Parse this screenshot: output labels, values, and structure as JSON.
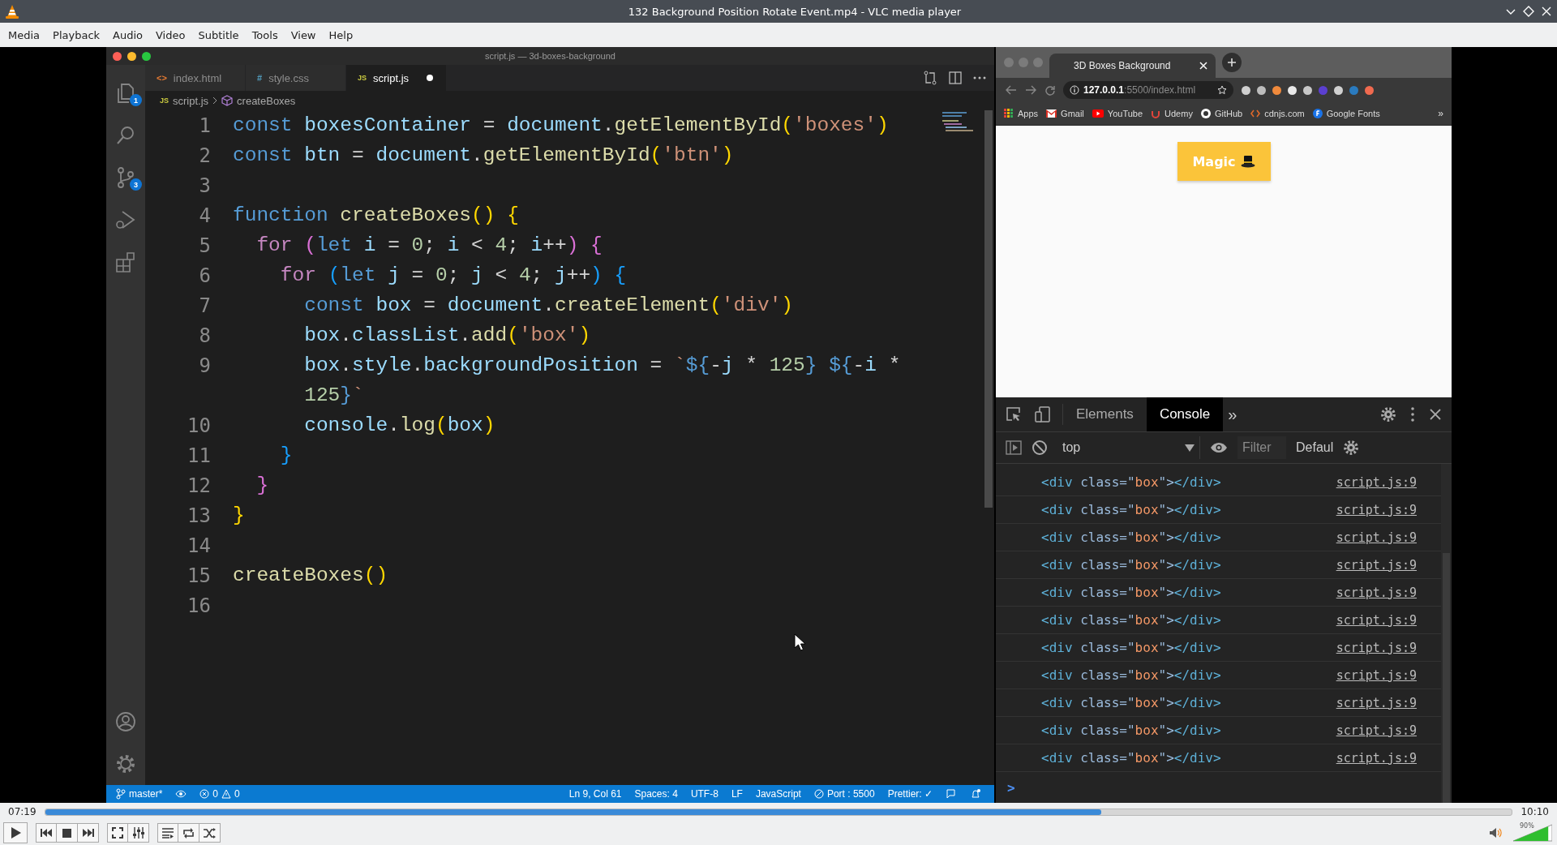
{
  "window": {
    "title": "132 Background Position Rotate Event.mp4 - VLC media player"
  },
  "menu": [
    "Media",
    "Playback",
    "Audio",
    "Video",
    "Subtitle",
    "Tools",
    "View",
    "Help"
  ],
  "editor": {
    "title": "script.js — 3d-boxes-background",
    "activity_bar": [
      {
        "kind": "files",
        "badge": "1"
      },
      {
        "kind": "search"
      },
      {
        "kind": "source-control",
        "badge": "3"
      },
      {
        "kind": "run"
      },
      {
        "kind": "extensions"
      }
    ],
    "activity_bottom": [
      {
        "kind": "account"
      },
      {
        "kind": "settings"
      }
    ],
    "tabs": [
      {
        "icon": "<>",
        "kind": "html",
        "label": "index.html",
        "selected": false,
        "modified": false
      },
      {
        "icon": "#",
        "kind": "css",
        "label": "style.css",
        "selected": false,
        "modified": false
      },
      {
        "icon": "JS",
        "kind": "js",
        "label": "script.js",
        "selected": true,
        "modified": true
      }
    ],
    "breadcrumb": [
      {
        "kind": "file",
        "icon": "JS",
        "label": "script.js"
      },
      {
        "kind": "symbol",
        "label": "createBoxes"
      }
    ],
    "lines": [
      {
        "number": "1",
        "tokens": [
          {
            "text": "const ",
            "kind": "kw"
          },
          {
            "text": "boxesContainer",
            "kind": "var"
          },
          {
            "text": " = ",
            "kind": "op"
          },
          {
            "text": "document",
            "kind": "var"
          },
          {
            "text": ".",
            "kind": "op"
          },
          {
            "text": "getElementById",
            "kind": "fn"
          },
          {
            "text": "(",
            "kind": "b1"
          },
          {
            "text": "'boxes'",
            "kind": "str"
          },
          {
            "text": ")",
            "kind": "b1"
          }
        ]
      },
      {
        "number": "2",
        "tokens": [
          {
            "text": "const ",
            "kind": "kw"
          },
          {
            "text": "btn",
            "kind": "var"
          },
          {
            "text": " = ",
            "kind": "op"
          },
          {
            "text": "document",
            "kind": "var"
          },
          {
            "text": ".",
            "kind": "op"
          },
          {
            "text": "getElementById",
            "kind": "fn"
          },
          {
            "text": "(",
            "kind": "b1"
          },
          {
            "text": "'btn'",
            "kind": "str"
          },
          {
            "text": ")",
            "kind": "b1"
          }
        ]
      },
      {
        "number": "3"
      },
      {
        "number": "4",
        "tokens": [
          {
            "text": "function ",
            "kind": "kw"
          },
          {
            "text": "createBoxes",
            "kind": "fn"
          },
          {
            "text": "() {",
            "kind": "b1"
          }
        ]
      },
      {
        "number": "5",
        "tokens": [
          {
            "text": "  for ",
            "kind": "ctrl"
          },
          {
            "text": "(",
            "kind": "b2"
          },
          {
            "text": "let ",
            "kind": "kw"
          },
          {
            "text": "i",
            "kind": "var"
          },
          {
            "text": " = ",
            "kind": "op"
          },
          {
            "text": "0",
            "kind": "num"
          },
          {
            "text": "; ",
            "kind": "op"
          },
          {
            "text": "i",
            "kind": "var"
          },
          {
            "text": " < ",
            "kind": "op"
          },
          {
            "text": "4",
            "kind": "num"
          },
          {
            "text": "; ",
            "kind": "op"
          },
          {
            "text": "i",
            "kind": "var"
          },
          {
            "text": "++",
            "kind": "op"
          },
          {
            "text": ") {",
            "kind": "b2"
          }
        ]
      },
      {
        "number": "6",
        "tokens": [
          {
            "text": "    for ",
            "kind": "ctrl"
          },
          {
            "text": "(",
            "kind": "b3"
          },
          {
            "text": "let ",
            "kind": "kw"
          },
          {
            "text": "j",
            "kind": "var"
          },
          {
            "text": " = ",
            "kind": "op"
          },
          {
            "text": "0",
            "kind": "num"
          },
          {
            "text": "; ",
            "kind": "op"
          },
          {
            "text": "j",
            "kind": "var"
          },
          {
            "text": " < ",
            "kind": "op"
          },
          {
            "text": "4",
            "kind": "num"
          },
          {
            "text": "; ",
            "kind": "op"
          },
          {
            "text": "j",
            "kind": "var"
          },
          {
            "text": "++",
            "kind": "op"
          },
          {
            "text": ") {",
            "kind": "b3"
          }
        ]
      },
      {
        "number": "7",
        "tokens": [
          {
            "text": "      const ",
            "kind": "kw"
          },
          {
            "text": "box",
            "kind": "var"
          },
          {
            "text": " = ",
            "kind": "op"
          },
          {
            "text": "document",
            "kind": "var"
          },
          {
            "text": ".",
            "kind": "op"
          },
          {
            "text": "createElement",
            "kind": "fn"
          },
          {
            "text": "(",
            "kind": "b1"
          },
          {
            "text": "'div'",
            "kind": "str"
          },
          {
            "text": ")",
            "kind": "b1"
          }
        ]
      },
      {
        "number": "8",
        "tokens": [
          {
            "text": "      box",
            "kind": "var"
          },
          {
            "text": ".",
            "kind": "op"
          },
          {
            "text": "classList",
            "kind": "var"
          },
          {
            "text": ".",
            "kind": "op"
          },
          {
            "text": "add",
            "kind": "fn"
          },
          {
            "text": "(",
            "kind": "b1"
          },
          {
            "text": "'box'",
            "kind": "str"
          },
          {
            "text": ")",
            "kind": "b1"
          }
        ]
      },
      {
        "number": "9",
        "tokens": [
          {
            "text": "      box",
            "kind": "var"
          },
          {
            "text": ".",
            "kind": "op"
          },
          {
            "text": "style",
            "kind": "var"
          },
          {
            "text": ".",
            "kind": "op"
          },
          {
            "text": "backgroundPosition",
            "kind": "var"
          },
          {
            "text": " = ",
            "kind": "op"
          },
          {
            "text": "`",
            "kind": "str"
          },
          {
            "text": "${",
            "kind": "kw"
          },
          {
            "text": "-",
            "kind": "op"
          },
          {
            "text": "j",
            "kind": "var"
          },
          {
            "text": " * ",
            "kind": "op"
          },
          {
            "text": "125",
            "kind": "num"
          },
          {
            "text": "}",
            "kind": "kw"
          },
          {
            "text": " ${",
            "kind": "kw"
          },
          {
            "text": "-",
            "kind": "op"
          },
          {
            "text": "i",
            "kind": "var"
          },
          {
            "text": " *",
            "kind": "op"
          }
        ],
        "continuation": [
          {
            "text": "      125",
            "kind": "num"
          },
          {
            "text": "}",
            "kind": "kw"
          },
          {
            "text": "`",
            "kind": "str"
          }
        ]
      },
      {
        "number": "10",
        "tokens": [
          {
            "text": "      console",
            "kind": "var"
          },
          {
            "text": ".",
            "kind": "op"
          },
          {
            "text": "log",
            "kind": "fn"
          },
          {
            "text": "(",
            "kind": "b1"
          },
          {
            "text": "box",
            "kind": "var"
          },
          {
            "text": ")",
            "kind": "b1"
          }
        ]
      },
      {
        "number": "11",
        "tokens": [
          {
            "text": "    }",
            "kind": "b3"
          }
        ]
      },
      {
        "number": "12",
        "tokens": [
          {
            "text": "  }",
            "kind": "b2"
          }
        ]
      },
      {
        "number": "13",
        "tokens": [
          {
            "text": "}",
            "kind": "b1"
          }
        ]
      },
      {
        "number": "14"
      },
      {
        "number": "15",
        "tokens": [
          {
            "text": "createBoxes",
            "kind": "fn"
          },
          {
            "text": "()",
            "kind": "b1"
          }
        ]
      },
      {
        "number": "16"
      }
    ],
    "status_bar": {
      "left": [
        {
          "kind": "branch",
          "label": "master*"
        },
        {
          "kind": "sync"
        },
        {
          "kind": "problems",
          "errors": "0",
          "warnings": "0"
        }
      ],
      "right": [
        {
          "kind": "text",
          "label": "Ln 9, Col 61"
        },
        {
          "kind": "text",
          "label": "Spaces: 4"
        },
        {
          "kind": "text",
          "label": "UTF-8"
        },
        {
          "kind": "text",
          "label": "LF"
        },
        {
          "kind": "text",
          "label": "JavaScript"
        },
        {
          "kind": "port",
          "label": "Port : 5500"
        },
        {
          "kind": "text",
          "label": "Prettier: ✓"
        },
        {
          "kind": "feedback"
        },
        {
          "kind": "bell"
        }
      ]
    }
  },
  "browser": {
    "tab": {
      "title": "3D Boxes Background"
    },
    "url": {
      "host": "127.0.0.1",
      "path": ":5500/index.html"
    },
    "extensions": [
      {
        "color": "#cfcfcf"
      },
      {
        "color": "#bdbdbd"
      },
      {
        "color": "#f08a3c"
      },
      {
        "color": "#e8e8e8"
      },
      {
        "color": "#c7c7c7"
      },
      {
        "color": "#5b3fd0"
      },
      {
        "color": "#d0d0d0"
      },
      {
        "color": "#2a7bbf"
      },
      {
        "color": "#f06a4f"
      }
    ],
    "bookmarks": [
      {
        "kind": "apps",
        "label": "Apps"
      },
      {
        "kind": "gmail",
        "label": "Gmail"
      },
      {
        "kind": "youtube",
        "label": "YouTube"
      },
      {
        "kind": "udemy",
        "label": "Udemy"
      },
      {
        "kind": "github",
        "label": "GitHub"
      },
      {
        "kind": "cdnjs",
        "label": "cdnjs.com"
      },
      {
        "kind": "fonts",
        "label": "Google Fonts"
      }
    ],
    "bookmarks_more": "»",
    "page": {
      "button": "Magic"
    },
    "devtools": {
      "tabs": [
        {
          "label": "Elements",
          "selected": false
        },
        {
          "label": "Console",
          "selected": true
        }
      ],
      "more": "»",
      "context": "top",
      "filter": {
        "placeholder": "Filter"
      },
      "levels": "Defaul",
      "messages": [
        {
          "tokens": [
            {
              "text": "<div ",
              "kind": "tag"
            },
            {
              "text": "class=\"",
              "kind": "attr"
            },
            {
              "text": "box",
              "kind": "str"
            },
            {
              "text": "\">",
              "kind": "attr"
            },
            {
              "text": "</div>",
              "kind": "tag"
            }
          ],
          "source": "script.js:9"
        },
        {
          "tokens": [
            {
              "text": "<div ",
              "kind": "tag"
            },
            {
              "text": "class=\"",
              "kind": "attr"
            },
            {
              "text": "box",
              "kind": "str"
            },
            {
              "text": "\">",
              "kind": "attr"
            },
            {
              "text": "</div>",
              "kind": "tag"
            }
          ],
          "source": "script.js:9"
        },
        {
          "tokens": [
            {
              "text": "<div ",
              "kind": "tag"
            },
            {
              "text": "class=\"",
              "kind": "attr"
            },
            {
              "text": "box",
              "kind": "str"
            },
            {
              "text": "\">",
              "kind": "attr"
            },
            {
              "text": "</div>",
              "kind": "tag"
            }
          ],
          "source": "script.js:9"
        },
        {
          "tokens": [
            {
              "text": "<div ",
              "kind": "tag"
            },
            {
              "text": "class=\"",
              "kind": "attr"
            },
            {
              "text": "box",
              "kind": "str"
            },
            {
              "text": "\">",
              "kind": "attr"
            },
            {
              "text": "</div>",
              "kind": "tag"
            }
          ],
          "source": "script.js:9"
        },
        {
          "tokens": [
            {
              "text": "<div ",
              "kind": "tag"
            },
            {
              "text": "class=\"",
              "kind": "attr"
            },
            {
              "text": "box",
              "kind": "str"
            },
            {
              "text": "\">",
              "kind": "attr"
            },
            {
              "text": "</div>",
              "kind": "tag"
            }
          ],
          "source": "script.js:9"
        },
        {
          "tokens": [
            {
              "text": "<div ",
              "kind": "tag"
            },
            {
              "text": "class=\"",
              "kind": "attr"
            },
            {
              "text": "box",
              "kind": "str"
            },
            {
              "text": "\">",
              "kind": "attr"
            },
            {
              "text": "</div>",
              "kind": "tag"
            }
          ],
          "source": "script.js:9"
        },
        {
          "tokens": [
            {
              "text": "<div ",
              "kind": "tag"
            },
            {
              "text": "class=\"",
              "kind": "attr"
            },
            {
              "text": "box",
              "kind": "str"
            },
            {
              "text": "\">",
              "kind": "attr"
            },
            {
              "text": "</div>",
              "kind": "tag"
            }
          ],
          "source": "script.js:9"
        },
        {
          "tokens": [
            {
              "text": "<div ",
              "kind": "tag"
            },
            {
              "text": "class=\"",
              "kind": "attr"
            },
            {
              "text": "box",
              "kind": "str"
            },
            {
              "text": "\">",
              "kind": "attr"
            },
            {
              "text": "</div>",
              "kind": "tag"
            }
          ],
          "source": "script.js:9"
        },
        {
          "tokens": [
            {
              "text": "<div ",
              "kind": "tag"
            },
            {
              "text": "class=\"",
              "kind": "attr"
            },
            {
              "text": "box",
              "kind": "str"
            },
            {
              "text": "\">",
              "kind": "attr"
            },
            {
              "text": "</div>",
              "kind": "tag"
            }
          ],
          "source": "script.js:9"
        },
        {
          "tokens": [
            {
              "text": "<div ",
              "kind": "tag"
            },
            {
              "text": "class=\"",
              "kind": "attr"
            },
            {
              "text": "box",
              "kind": "str"
            },
            {
              "text": "\">",
              "kind": "attr"
            },
            {
              "text": "</div>",
              "kind": "tag"
            }
          ],
          "source": "script.js:9"
        },
        {
          "tokens": [
            {
              "text": "<div ",
              "kind": "tag"
            },
            {
              "text": "class=\"",
              "kind": "attr"
            },
            {
              "text": "box",
              "kind": "str"
            },
            {
              "text": "\">",
              "kind": "attr"
            },
            {
              "text": "</div>",
              "kind": "tag"
            }
          ],
          "source": "script.js:9"
        }
      ],
      "prompt": ">"
    }
  },
  "player": {
    "elapsed": "07:19",
    "total": "10:10",
    "progress": {
      "level": 0.72
    },
    "control_groups": [
      [
        {
          "kind": "play"
        }
      ],
      [
        {
          "kind": "previous"
        },
        {
          "kind": "stop"
        },
        {
          "kind": "next"
        }
      ],
      [
        {
          "kind": "fullscreen"
        },
        {
          "kind": "extended"
        }
      ],
      [
        {
          "kind": "playlist"
        },
        {
          "kind": "loop"
        },
        {
          "kind": "shuffle"
        }
      ]
    ],
    "volume": {
      "level": 0.9,
      "reading": "90%"
    }
  }
}
